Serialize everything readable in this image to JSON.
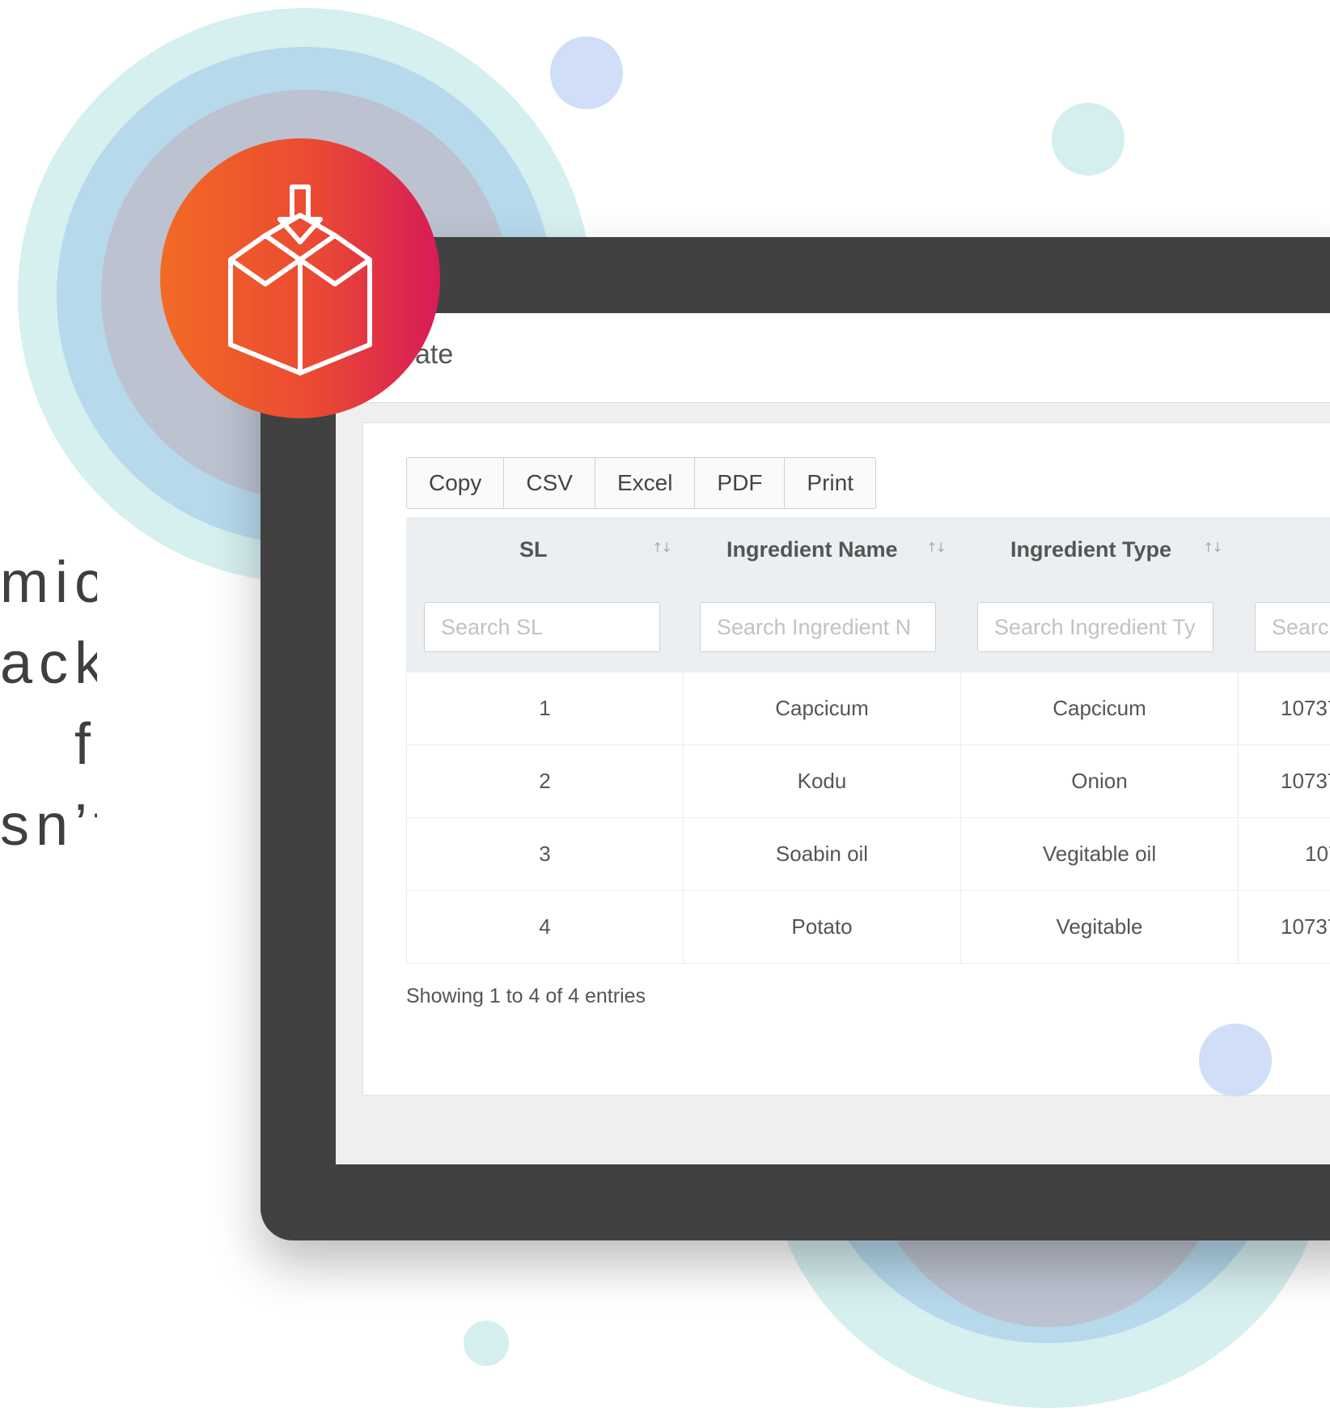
{
  "side_text": [
    "mic",
    "ack",
    "f",
    "sn’t"
  ],
  "page": {
    "title": "ate"
  },
  "export_buttons": [
    "Copy",
    "CSV",
    "Excel",
    "PDF",
    "Print"
  ],
  "table": {
    "columns": [
      "SL",
      "Ingredient Name",
      "Ingredient Type",
      ""
    ],
    "search_placeholders": [
      "Search SL",
      "Search Ingredient N",
      "Search Ingredient Ty",
      "Searc"
    ],
    "rows": [
      [
        "1",
        "Capcicum",
        "Capcicum",
        "10737"
      ],
      [
        "2",
        "Kodu",
        "Onion",
        "10737"
      ],
      [
        "3",
        "Soabin oil",
        "Vegitable oil",
        "107"
      ],
      [
        "4",
        "Potato",
        "Vegitable",
        "10737"
      ]
    ],
    "info": "Showing 1 to 4 of 4 entries"
  },
  "icons": {
    "badge": "package-download-icon",
    "sort": "sort-arrows-icon"
  },
  "colors": {
    "frame": "#414141",
    "badge_gradient": [
      "#f26a24",
      "#d81b57"
    ],
    "ring_outer": "#d6efef",
    "ring_mid": "#b6d9ec",
    "ring_inner": "#bcc2d0",
    "dot_blue": "#d0def7",
    "dot_teal": "#d4efed"
  }
}
